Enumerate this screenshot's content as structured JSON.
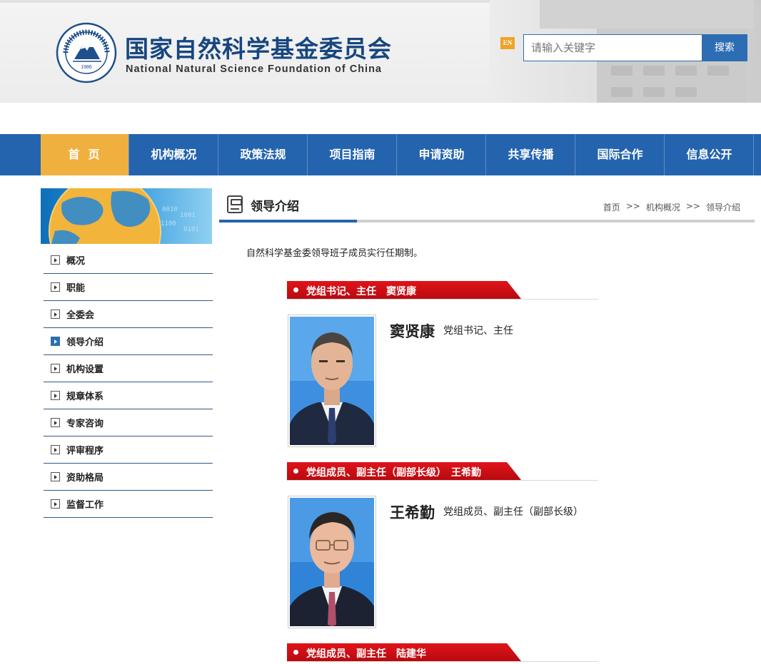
{
  "header": {
    "logo_cn": "国家自然科学基金委员会",
    "logo_en": "National Natural Science Foundation of China",
    "seal_year": "1986",
    "lang_badge": "EN",
    "search": {
      "placeholder": "请输入关键字",
      "button": "搜索"
    }
  },
  "nav": [
    "首页",
    "机构概况",
    "政策法规",
    "项目指南",
    "申请资助",
    "共享传播",
    "国际合作",
    "信息公开"
  ],
  "sidebar": {
    "items": [
      {
        "label": "概况"
      },
      {
        "label": "职能"
      },
      {
        "label": "全委会"
      },
      {
        "label": "领导介绍",
        "active": true
      },
      {
        "label": "机构设置"
      },
      {
        "label": "规章体系"
      },
      {
        "label": "专家咨询"
      },
      {
        "label": "评审程序"
      },
      {
        "label": "资助格局"
      },
      {
        "label": "监督工作"
      }
    ]
  },
  "main": {
    "section_title": "领导介绍",
    "breadcrumb": [
      "首页",
      "机构概况",
      "领导介绍"
    ],
    "breadcrumb_sep": ">>",
    "intro": "自然科学基金委领导班子成员实行任期制。",
    "leaders": [
      {
        "bar": "党组书记、主任　窦贤康",
        "name": "窦贤康",
        "role": "党组书记、主任"
      },
      {
        "bar": "党组成员、副主任（副部长级）　王希勤",
        "name": "王希勤",
        "role": "党组成员、副主任（副部长级）"
      },
      {
        "bar": "党组成员、副主任　陆建华"
      }
    ]
  },
  "colors": {
    "brand_blue": "#2464ae",
    "nav_active": "#f0b040",
    "accent_red": "#d0121a"
  }
}
